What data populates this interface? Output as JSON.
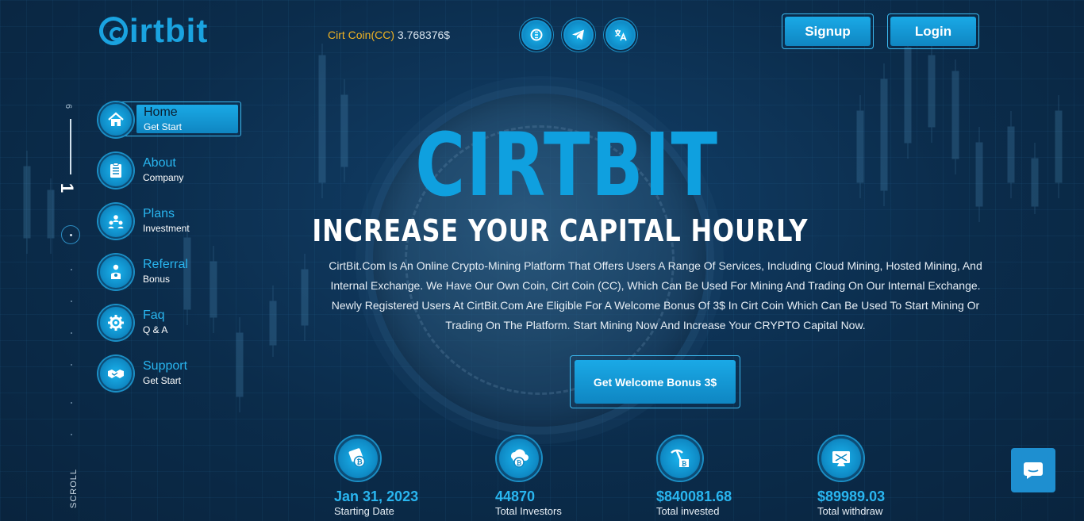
{
  "brand": {
    "logo_text": "irtbit"
  },
  "header": {
    "coin_name": "Cirt Coin(CC)",
    "coin_price": "3.768376$",
    "icons": [
      "coin-icon",
      "telegram-icon",
      "translate-icon"
    ],
    "signup_label": "Signup",
    "login_label": "Login"
  },
  "rail": {
    "total": "6",
    "current": "1",
    "scroll_label": "SCROLL"
  },
  "nav": {
    "items": [
      {
        "title": "Home",
        "sub": "Get Start",
        "icon": "home-icon",
        "active": true
      },
      {
        "title": "About",
        "sub": "Company",
        "icon": "clipboard-icon"
      },
      {
        "title": "Plans",
        "sub": "Investment",
        "icon": "users-icon"
      },
      {
        "title": "Referral",
        "sub": "Bonus",
        "icon": "person-icon"
      },
      {
        "title": "Faq",
        "sub": "Q & A",
        "icon": "gear-icon"
      },
      {
        "title": "Support",
        "sub": "Get Start",
        "icon": "handshake-icon"
      }
    ]
  },
  "hero": {
    "title": "CIRTBIT",
    "subtitle": "INCREASE YOUR CAPITAL HOURLY",
    "description": "CirtBit.Com Is An Online Crypto-Mining Platform That Offers Users A Range Of Services, Including Cloud Mining, Hosted Mining, And Internal Exchange. We Have Our Own Coin, Cirt Coin (CC), Which Can Be Used For Mining And Trading On Our Internal Exchange. Newly Registered Users At CirtBit.Com Are Eligible For A Welcome Bonus Of 3$ In Cirt Coin Which Can Be Used To Start Mining Or Trading On The Platform. Start Mining Now And Increase Your CRYPTO Capital Now.",
    "cta_label": "Get Welcome Bonus 3$"
  },
  "stats": [
    {
      "value": "Jan 31, 2023",
      "label": "Starting Date",
      "icon": "calendar-coin-icon"
    },
    {
      "value": "44870",
      "label": "Total Investors",
      "icon": "cloud-coin-icon"
    },
    {
      "value": "$840081.68",
      "label": "Total invested",
      "icon": "mining-icon"
    },
    {
      "value": "$89989.03",
      "label": "Total withdraw",
      "icon": "monitor-icon"
    }
  ],
  "colors": {
    "accent": "#1aa3e0",
    "coin_name": "#f0b323",
    "background": "#0b2a47"
  }
}
